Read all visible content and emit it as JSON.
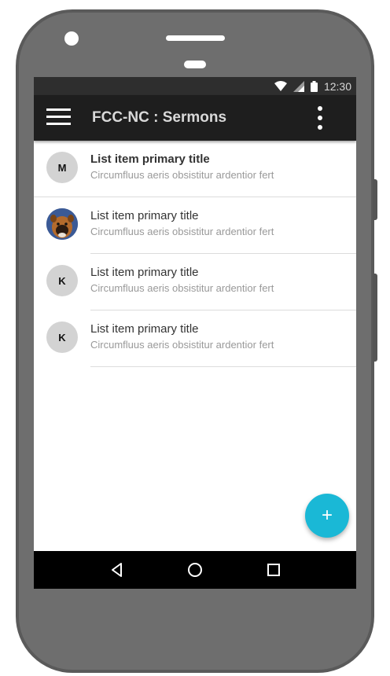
{
  "status_bar": {
    "time": "12:30",
    "icons": [
      "wifi-icon",
      "signal-icon",
      "battery-icon"
    ]
  },
  "app_bar": {
    "title": "FCC-NC : Sermons",
    "menu_icon": "hamburger-menu-icon",
    "overflow_icon": "more-vert-icon"
  },
  "list": {
    "items": [
      {
        "avatar_letter": "M",
        "title": "List item primary title",
        "subtitle": "Circumfluus aeris obsistitur ardentior fert",
        "avatar_type": "letter"
      },
      {
        "avatar_letter": "",
        "title": "List item primary title",
        "subtitle": "Circumfluus aeris obsistitur ardentior fert",
        "avatar_type": "photo-dog"
      },
      {
        "avatar_letter": "K",
        "title": "List item primary title",
        "subtitle": "Circumfluus aeris obsistitur ardentior fert",
        "avatar_type": "letter"
      },
      {
        "avatar_letter": "K",
        "title": "List item primary title",
        "subtitle": "Circumfluus aeris obsistitur ardentior fert",
        "avatar_type": "letter"
      }
    ]
  },
  "fab": {
    "label": "+",
    "icon": "add-icon"
  },
  "nav_bar": {
    "icons": [
      "back-icon",
      "home-icon",
      "recents-icon"
    ]
  },
  "colors": {
    "app_bar": "#1e1e1e",
    "status_bar": "#2e2e2e",
    "fab": "#1ab8d6",
    "phone_body": "#6e6e6e"
  }
}
